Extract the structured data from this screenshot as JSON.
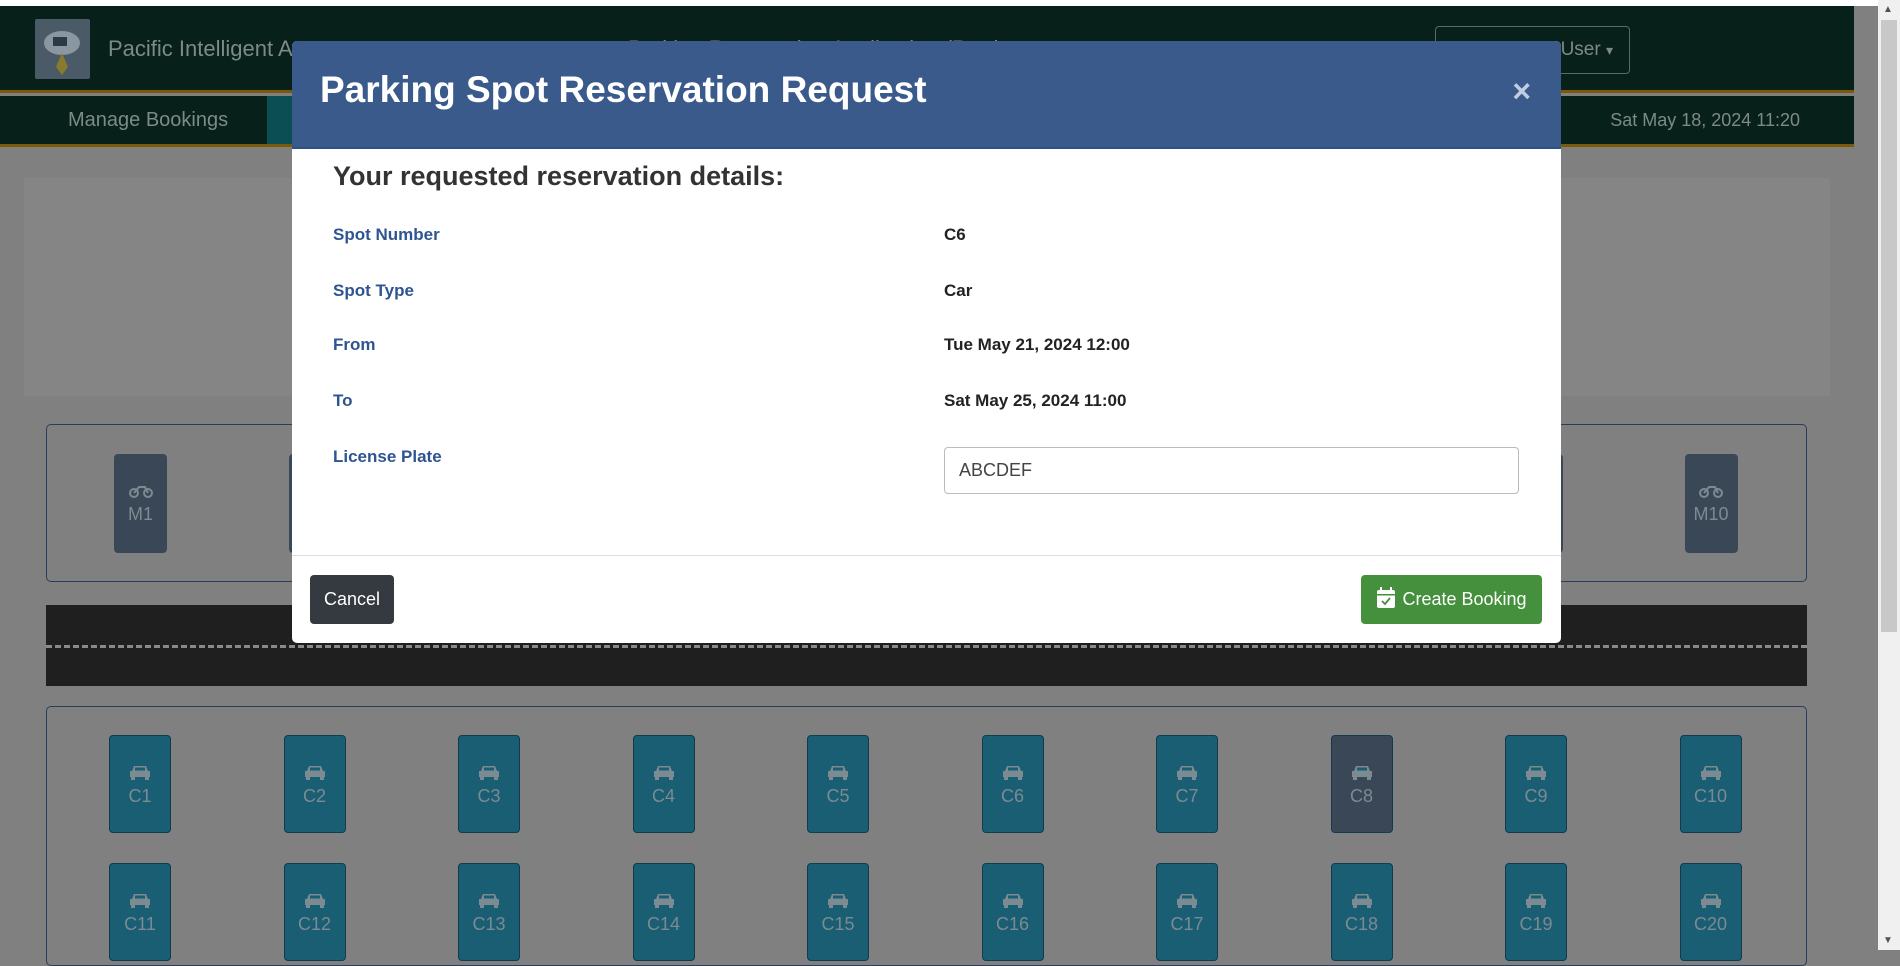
{
  "header": {
    "brand": "Pacific Intelligent A",
    "app_title": "Parking Reservation Application (Prod",
    "user_label": "User",
    "user_caret": "▾"
  },
  "nav": {
    "items": [
      {
        "label": "Manage Bookings"
      }
    ],
    "datetime": "Sat May 18, 2024 11:20"
  },
  "lot": {
    "moto_spots": [
      {
        "label": "M1"
      },
      {
        "label": ""
      },
      {
        "label": ""
      },
      {
        "label": ""
      },
      {
        "label": ""
      },
      {
        "label": ""
      },
      {
        "label": ""
      },
      {
        "label": ""
      },
      {
        "label": ""
      },
      {
        "label": "M10"
      }
    ],
    "car_spots": [
      {
        "label": "C1",
        "status": "available"
      },
      {
        "label": "C2",
        "status": "available"
      },
      {
        "label": "C3",
        "status": "available"
      },
      {
        "label": "C4",
        "status": "available"
      },
      {
        "label": "C5",
        "status": "available"
      },
      {
        "label": "C6",
        "status": "available"
      },
      {
        "label": "C7",
        "status": "available"
      },
      {
        "label": "C8",
        "status": "occupied"
      },
      {
        "label": "C9",
        "status": "available"
      },
      {
        "label": "C10",
        "status": "available"
      },
      {
        "label": "C11",
        "status": "available"
      },
      {
        "label": "C12",
        "status": "available"
      },
      {
        "label": "C13",
        "status": "available"
      },
      {
        "label": "C14",
        "status": "available"
      },
      {
        "label": "C15",
        "status": "available"
      },
      {
        "label": "C16",
        "status": "available"
      },
      {
        "label": "C17",
        "status": "available"
      },
      {
        "label": "C18",
        "status": "available"
      },
      {
        "label": "C19",
        "status": "available"
      },
      {
        "label": "C20",
        "status": "available"
      }
    ],
    "colors": {
      "available": "#1a5e74",
      "occupied": "#3a4757"
    }
  },
  "modal": {
    "title": "Parking Spot Reservation Request",
    "close": "×",
    "subtitle": "Your requested reservation details:",
    "fields": [
      {
        "label": "Spot Number",
        "value": "C6"
      },
      {
        "label": "Spot Type",
        "value": "Car"
      },
      {
        "label": "From",
        "value": "Tue May 21, 2024 12:00"
      },
      {
        "label": "To",
        "value": "Sat May 25, 2024 11:00"
      }
    ],
    "license_label": "License Plate",
    "license_value": "ABCDEF",
    "cancel": "Cancel",
    "create": "Create Booking",
    "colors": {
      "header": "#3a5a8c",
      "create": "#44903c",
      "cancel": "#343a40"
    }
  }
}
